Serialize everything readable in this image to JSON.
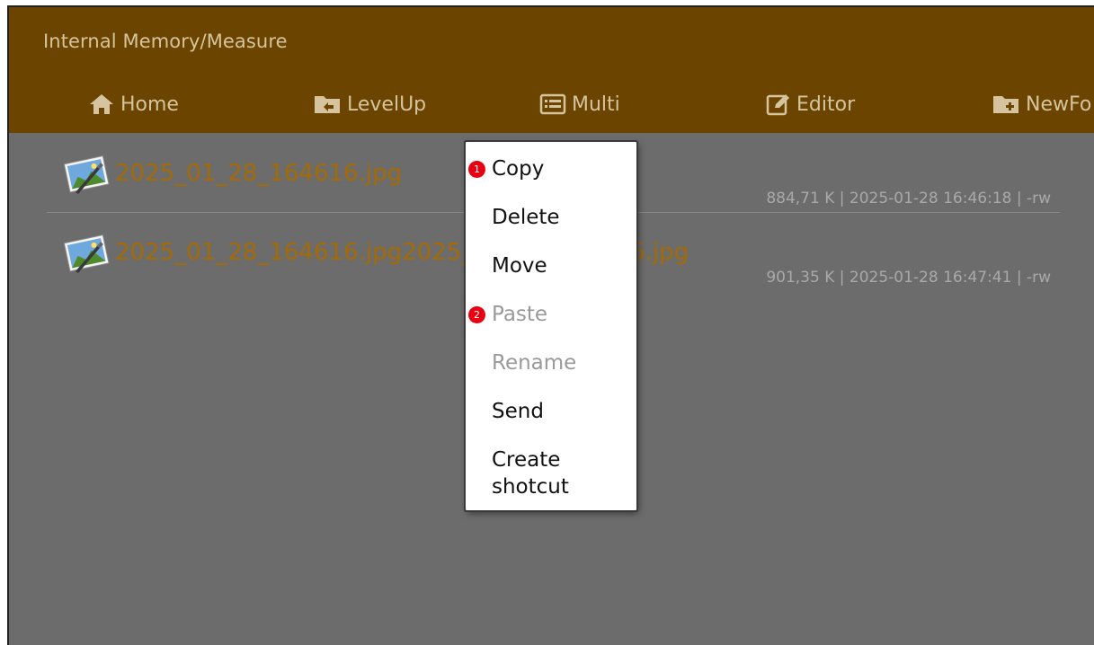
{
  "header": {
    "path": "Internal Memory/Measure"
  },
  "toolbar": {
    "home": "Home",
    "levelup": "LevelUp",
    "multi": "Multi",
    "editor": "Editor",
    "newfolder": "NewFo"
  },
  "files": [
    {
      "name": "2025_01_28_164616.jpg",
      "meta": "884,71 K | 2025-01-28 16:46:18 | -rw",
      "icon": "image-file-icon"
    },
    {
      "name": "2025_01_28_164616.jpg2025_01_28_164616.jpg",
      "meta": "901,35 K | 2025-01-28 16:47:41 | -rw",
      "icon": "image-file-icon"
    }
  ],
  "context_menu": {
    "items": [
      {
        "label": "Copy",
        "enabled": true,
        "badge": "1"
      },
      {
        "label": "Delete",
        "enabled": true
      },
      {
        "label": "Move",
        "enabled": true
      },
      {
        "label": "Paste",
        "enabled": false,
        "badge": "2"
      },
      {
        "label": "Rename",
        "enabled": false
      },
      {
        "label": "Send",
        "enabled": true
      },
      {
        "label": "Create",
        "enabled": true,
        "label2": "shotcut"
      }
    ]
  },
  "colors": {
    "header_bg": "#6b4500",
    "header_text": "#d6c49e",
    "list_bg": "#6c6c6c",
    "file_name": "#a36a06",
    "meta_text": "#a9a9a9",
    "badge": "#e60012"
  }
}
